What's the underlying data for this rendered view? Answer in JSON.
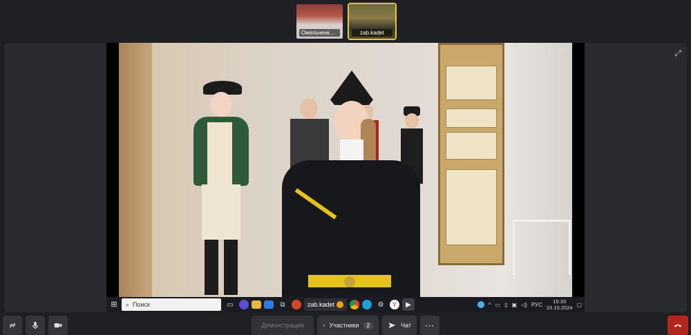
{
  "participants": [
    {
      "name": "Омельченко ..."
    },
    {
      "name": "zab.kadet"
    }
  ],
  "shared_screen": {
    "taskbar": {
      "search_placeholder": "Поиск",
      "active_app": "zab.kadet",
      "language": "РУС",
      "time": "15:33",
      "date": "23.10.2024"
    }
  },
  "controls": {
    "demo_label": "Демонстрация",
    "participants_label": "Участники",
    "participants_count": "2",
    "chat_label": "Чат"
  },
  "colors": {
    "active_border": "#e2c64a",
    "hangup": "#b3261e",
    "bar_bg": "#34363b"
  }
}
